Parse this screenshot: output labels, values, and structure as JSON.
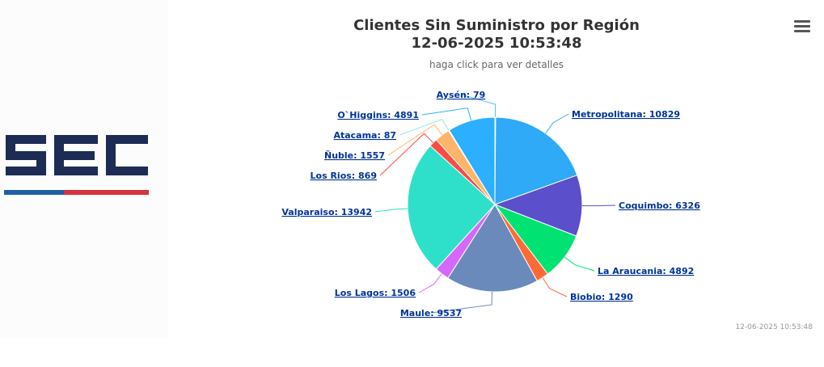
{
  "chart_data": {
    "type": "pie",
    "title": "Clientes Sin Suministro por Región",
    "title_line2": "12-06-2025 10:53:48",
    "subtitle": "haga click para ver detalles",
    "credits": "12-06-2025 10:53:48",
    "slices": [
      {
        "name": "Aysén",
        "value": 79,
        "color": "#4fc3f7",
        "label": "Aysén: 79"
      },
      {
        "name": "Metropolitana",
        "value": 10829,
        "color": "#2eaaf7",
        "label": "Metropolitana: 10829"
      },
      {
        "name": "Coquimbo",
        "value": 6326,
        "color": "#5b4fcb",
        "label": "Coquimbo: 6326"
      },
      {
        "name": "La Araucania",
        "value": 4892,
        "color": "#00e272",
        "label": "La Araucania: 4892"
      },
      {
        "name": "Biobio",
        "value": 1290,
        "color": "#fe6a35",
        "label": "Biobio: 1290"
      },
      {
        "name": "Maule",
        "value": 9537,
        "color": "#6b8abc",
        "label": "Maule: 9537"
      },
      {
        "name": "Los Lagos",
        "value": 1506,
        "color": "#d568fb",
        "label": "Los Lagos: 1506"
      },
      {
        "name": "Valparaiso",
        "value": 13942,
        "color": "#2ee0ca",
        "label": "Valparaiso: 13942"
      },
      {
        "name": "Los Rios",
        "value": 869,
        "color": "#fa4b42",
        "label": "Los Rios: 869"
      },
      {
        "name": "Ñuble",
        "value": 1557,
        "color": "#feb56a",
        "label": "Ñuble: 1557"
      },
      {
        "name": "Atacama",
        "value": 87,
        "color": "#91e8e1",
        "label": "Atacama: 87"
      },
      {
        "name": "O`Higgins",
        "value": 4891,
        "color": "#2caffe",
        "label": "O`Higgins: 4891"
      }
    ]
  },
  "colors": {
    "logo_navy": "#1c2c55",
    "logo_blue": "#1f5fa6",
    "logo_red": "#d8323c"
  }
}
